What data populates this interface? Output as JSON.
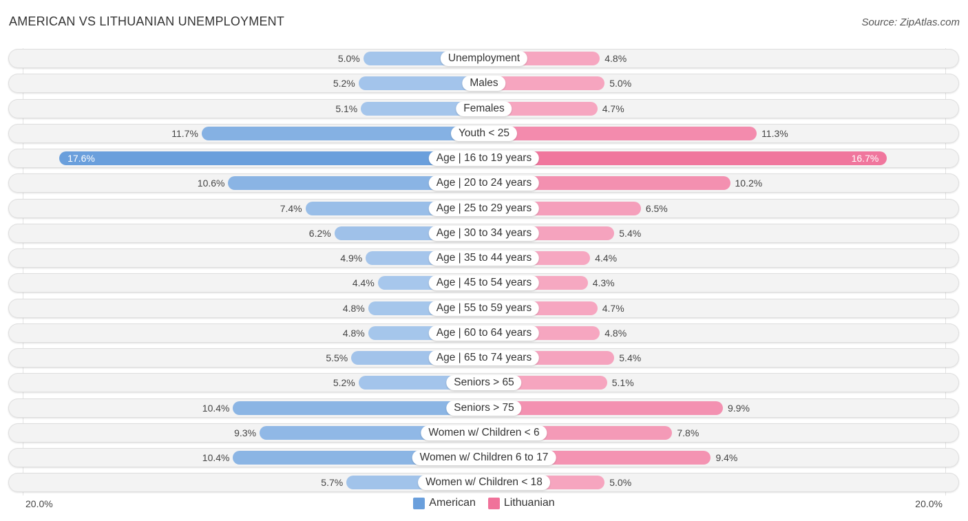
{
  "header": {
    "title": "AMERICAN VS LITHUANIAN UNEMPLOYMENT",
    "source": "Source: ZipAtlas.com"
  },
  "colors": {
    "american": "#6a9fdc",
    "american_light": "#a9c8ec",
    "lithuanian": "#f0729a",
    "lithuanian_light": "#f6a9c2"
  },
  "chart_data": {
    "type": "bar",
    "orientation": "horizontal-diverging",
    "title": "AMERICAN VS LITHUANIAN UNEMPLOYMENT",
    "categories": [
      "Unemployment",
      "Males",
      "Females",
      "Youth < 25",
      "Age | 16 to 19 years",
      "Age | 20 to 24 years",
      "Age | 25 to 29 years",
      "Age | 30 to 34 years",
      "Age | 35 to 44 years",
      "Age | 45 to 54 years",
      "Age | 55 to 59 years",
      "Age | 60 to 64 years",
      "Age | 65 to 74 years",
      "Seniors > 65",
      "Seniors > 75",
      "Women w/ Children < 6",
      "Women w/ Children 6 to 17",
      "Women w/ Children < 18"
    ],
    "series": [
      {
        "name": "American",
        "values": [
          5.0,
          5.2,
          5.1,
          11.7,
          17.6,
          10.6,
          7.4,
          6.2,
          4.9,
          4.4,
          4.8,
          4.8,
          5.5,
          5.2,
          10.4,
          9.3,
          10.4,
          5.7
        ]
      },
      {
        "name": "Lithuanian",
        "values": [
          4.8,
          5.0,
          4.7,
          11.3,
          16.7,
          10.2,
          6.5,
          5.4,
          4.4,
          4.3,
          4.7,
          4.8,
          5.4,
          5.1,
          9.9,
          7.8,
          9.4,
          5.0
        ]
      }
    ],
    "value_labels": {
      "American": [
        "5.0%",
        "5.2%",
        "5.1%",
        "11.7%",
        "17.6%",
        "10.6%",
        "7.4%",
        "6.2%",
        "4.9%",
        "4.4%",
        "4.8%",
        "4.8%",
        "5.5%",
        "5.2%",
        "10.4%",
        "9.3%",
        "10.4%",
        "5.7%"
      ],
      "Lithuanian": [
        "4.8%",
        "5.0%",
        "4.7%",
        "11.3%",
        "16.7%",
        "10.2%",
        "6.5%",
        "5.4%",
        "4.4%",
        "4.3%",
        "4.7%",
        "4.8%",
        "5.4%",
        "5.1%",
        "9.9%",
        "7.8%",
        "9.4%",
        "5.0%"
      ]
    },
    "xlim": [
      -20,
      20
    ],
    "axis_labels": {
      "left": "20.0%",
      "right": "20.0%"
    },
    "unit": "%",
    "legend": {
      "position": "bottom-center",
      "entries": [
        "American",
        "Lithuanian"
      ]
    },
    "grid": false
  }
}
